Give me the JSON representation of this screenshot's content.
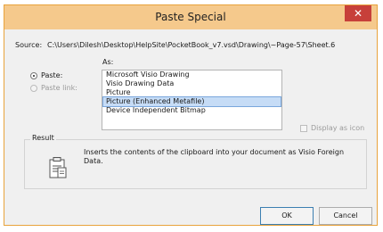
{
  "dialog": {
    "title": "Paste Special",
    "close_glyph": "✕",
    "source_label": "Source:",
    "source_value": "C:\\Users\\Dilesh\\Desktop\\HelpSite\\PocketBook_v7.vsd\\Drawing\\~Page-57\\Sheet.6",
    "as_label": "As:",
    "paste_label": "Paste:",
    "paste_link_label": "Paste link:",
    "formats": [
      "Microsoft Visio Drawing",
      "Visio Drawing Data",
      "Picture",
      "Picture (Enhanced Metafile)",
      "Device Independent Bitmap"
    ],
    "selected_format_index": 3,
    "display_as_icon_label": "Display as icon",
    "result_label": "Result",
    "result_text": "Inserts the contents of the clipboard into your document as Visio Foreign Data.",
    "ok_label": "OK",
    "cancel_label": "Cancel"
  },
  "icons": {
    "clipboard": "clipboard-icon"
  },
  "colors": {
    "titlebar": "#f5c98c",
    "close_button": "#c7403a",
    "selection": "#c6dcf6"
  }
}
